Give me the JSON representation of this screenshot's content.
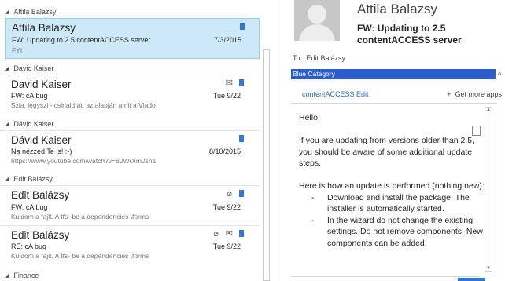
{
  "accent_color": "#2f78d6",
  "category_color": "#2b5dcd",
  "selected_bg": "#cde8f7",
  "message_list": {
    "groups": [
      {
        "header": "Attila Balazsy",
        "messages": [
          {
            "sender": "Attila Balazsy",
            "subject": "FW: Updating to 2.5 contentACCESS server",
            "preview": "FYI",
            "date": "7/3/2015",
            "icons": [
              "flag-icon"
            ],
            "selected": true
          }
        ]
      },
      {
        "header": "David Kaiser",
        "messages": [
          {
            "sender": "David Kaiser",
            "subject": "FW: cA bug",
            "preview": "Szia, légyszi - csináld át, az alapján amit a Vlado",
            "date": "Tue 9/22",
            "icons": [
              "forwarded-envelope-icon",
              "flag-icon"
            ],
            "selected": false
          }
        ]
      },
      {
        "header": "Dávid Kaiser",
        "messages": [
          {
            "sender": "Dávid Kaiser",
            "subject": "Na nézzed Te is! :-)",
            "preview": "https://www.youtube.com/watch?v=60WrXm0sn1",
            "date": "8/10/2015",
            "icons": [
              "flag-icon"
            ],
            "selected": false
          }
        ]
      },
      {
        "header": "Edit Balázsy",
        "messages": [
          {
            "sender": "Edit Balázsy",
            "subject": "FW: cA bug",
            "preview": "Kuldom a fajlt. A tfs- be a dependencies \\forms",
            "date": "Tue 9/22",
            "icons": [
              "attachment-icon",
              "flag-icon"
            ],
            "selected": false
          },
          {
            "sender": "Edit Balázsy",
            "subject": "RE: cA bug",
            "preview": "Kuldom a fajlt. A tfs- be a dependencies \\forms",
            "date": "Tue 9/22",
            "icons": [
              "attachment-icon",
              "forwarded-envelope-icon",
              "flag-icon"
            ],
            "selected": false
          }
        ]
      },
      {
        "header": "Finance",
        "messages": []
      }
    ]
  },
  "reading_pane": {
    "sender_name": "Attila Balazsy",
    "subject": "FW: Updating to 2.5 contentACCESS server",
    "to_label": "To",
    "to_name": "Edit Balázsy",
    "category": "Blue Category",
    "app_link": "contentACCESS Edit",
    "get_more_apps": "Get more apps",
    "body": {
      "greeting": "Hello,",
      "paragraph1": "If you are updating from versions older than 2.5, you should be aware of some additional update steps.",
      "paragraph2": "Here is how an update is performed (nothing new):",
      "steps": [
        "Download and install the package. The installer is automatically started.",
        "In the wizard do not change the existing settings. Do not remove components. New components can be added."
      ]
    }
  }
}
